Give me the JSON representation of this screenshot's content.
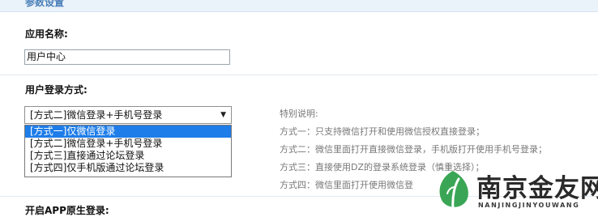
{
  "header": {
    "title": "参数设置"
  },
  "app_name": {
    "label": "应用名称:",
    "value": "用户中心"
  },
  "login_mode": {
    "label": "用户登录方式:",
    "selected": "[方式二]微信登录+手机号登录",
    "options": [
      "[方式一]仅微信登录",
      "[方式二]微信登录+手机号登录",
      "[方式三]直接通过论坛登录",
      "[方式四]仅手机版通过论坛登录"
    ]
  },
  "notes": {
    "title": "特别说明:",
    "lines": [
      "方式一：只支持微信打开和使用微信授权直接登录；",
      "方式二：微信里面打开直接微信登录，手机版打开使用手机号登录；",
      "方式三：直接使用DZ的登录系统登录（慎重选择）；",
      "方式四：微信里面打开使用微信登"
    ]
  },
  "native_login": {
    "label": "开启APP原生登录:"
  },
  "watermark": {
    "name": "南京金友网",
    "subtitle": "NANJINGJINYOUWANG",
    "accent": "#3aa655"
  },
  "colors": {
    "selection": "#1e7de8",
    "header_bg": "#eaf2fa",
    "note_text": "#777777"
  }
}
